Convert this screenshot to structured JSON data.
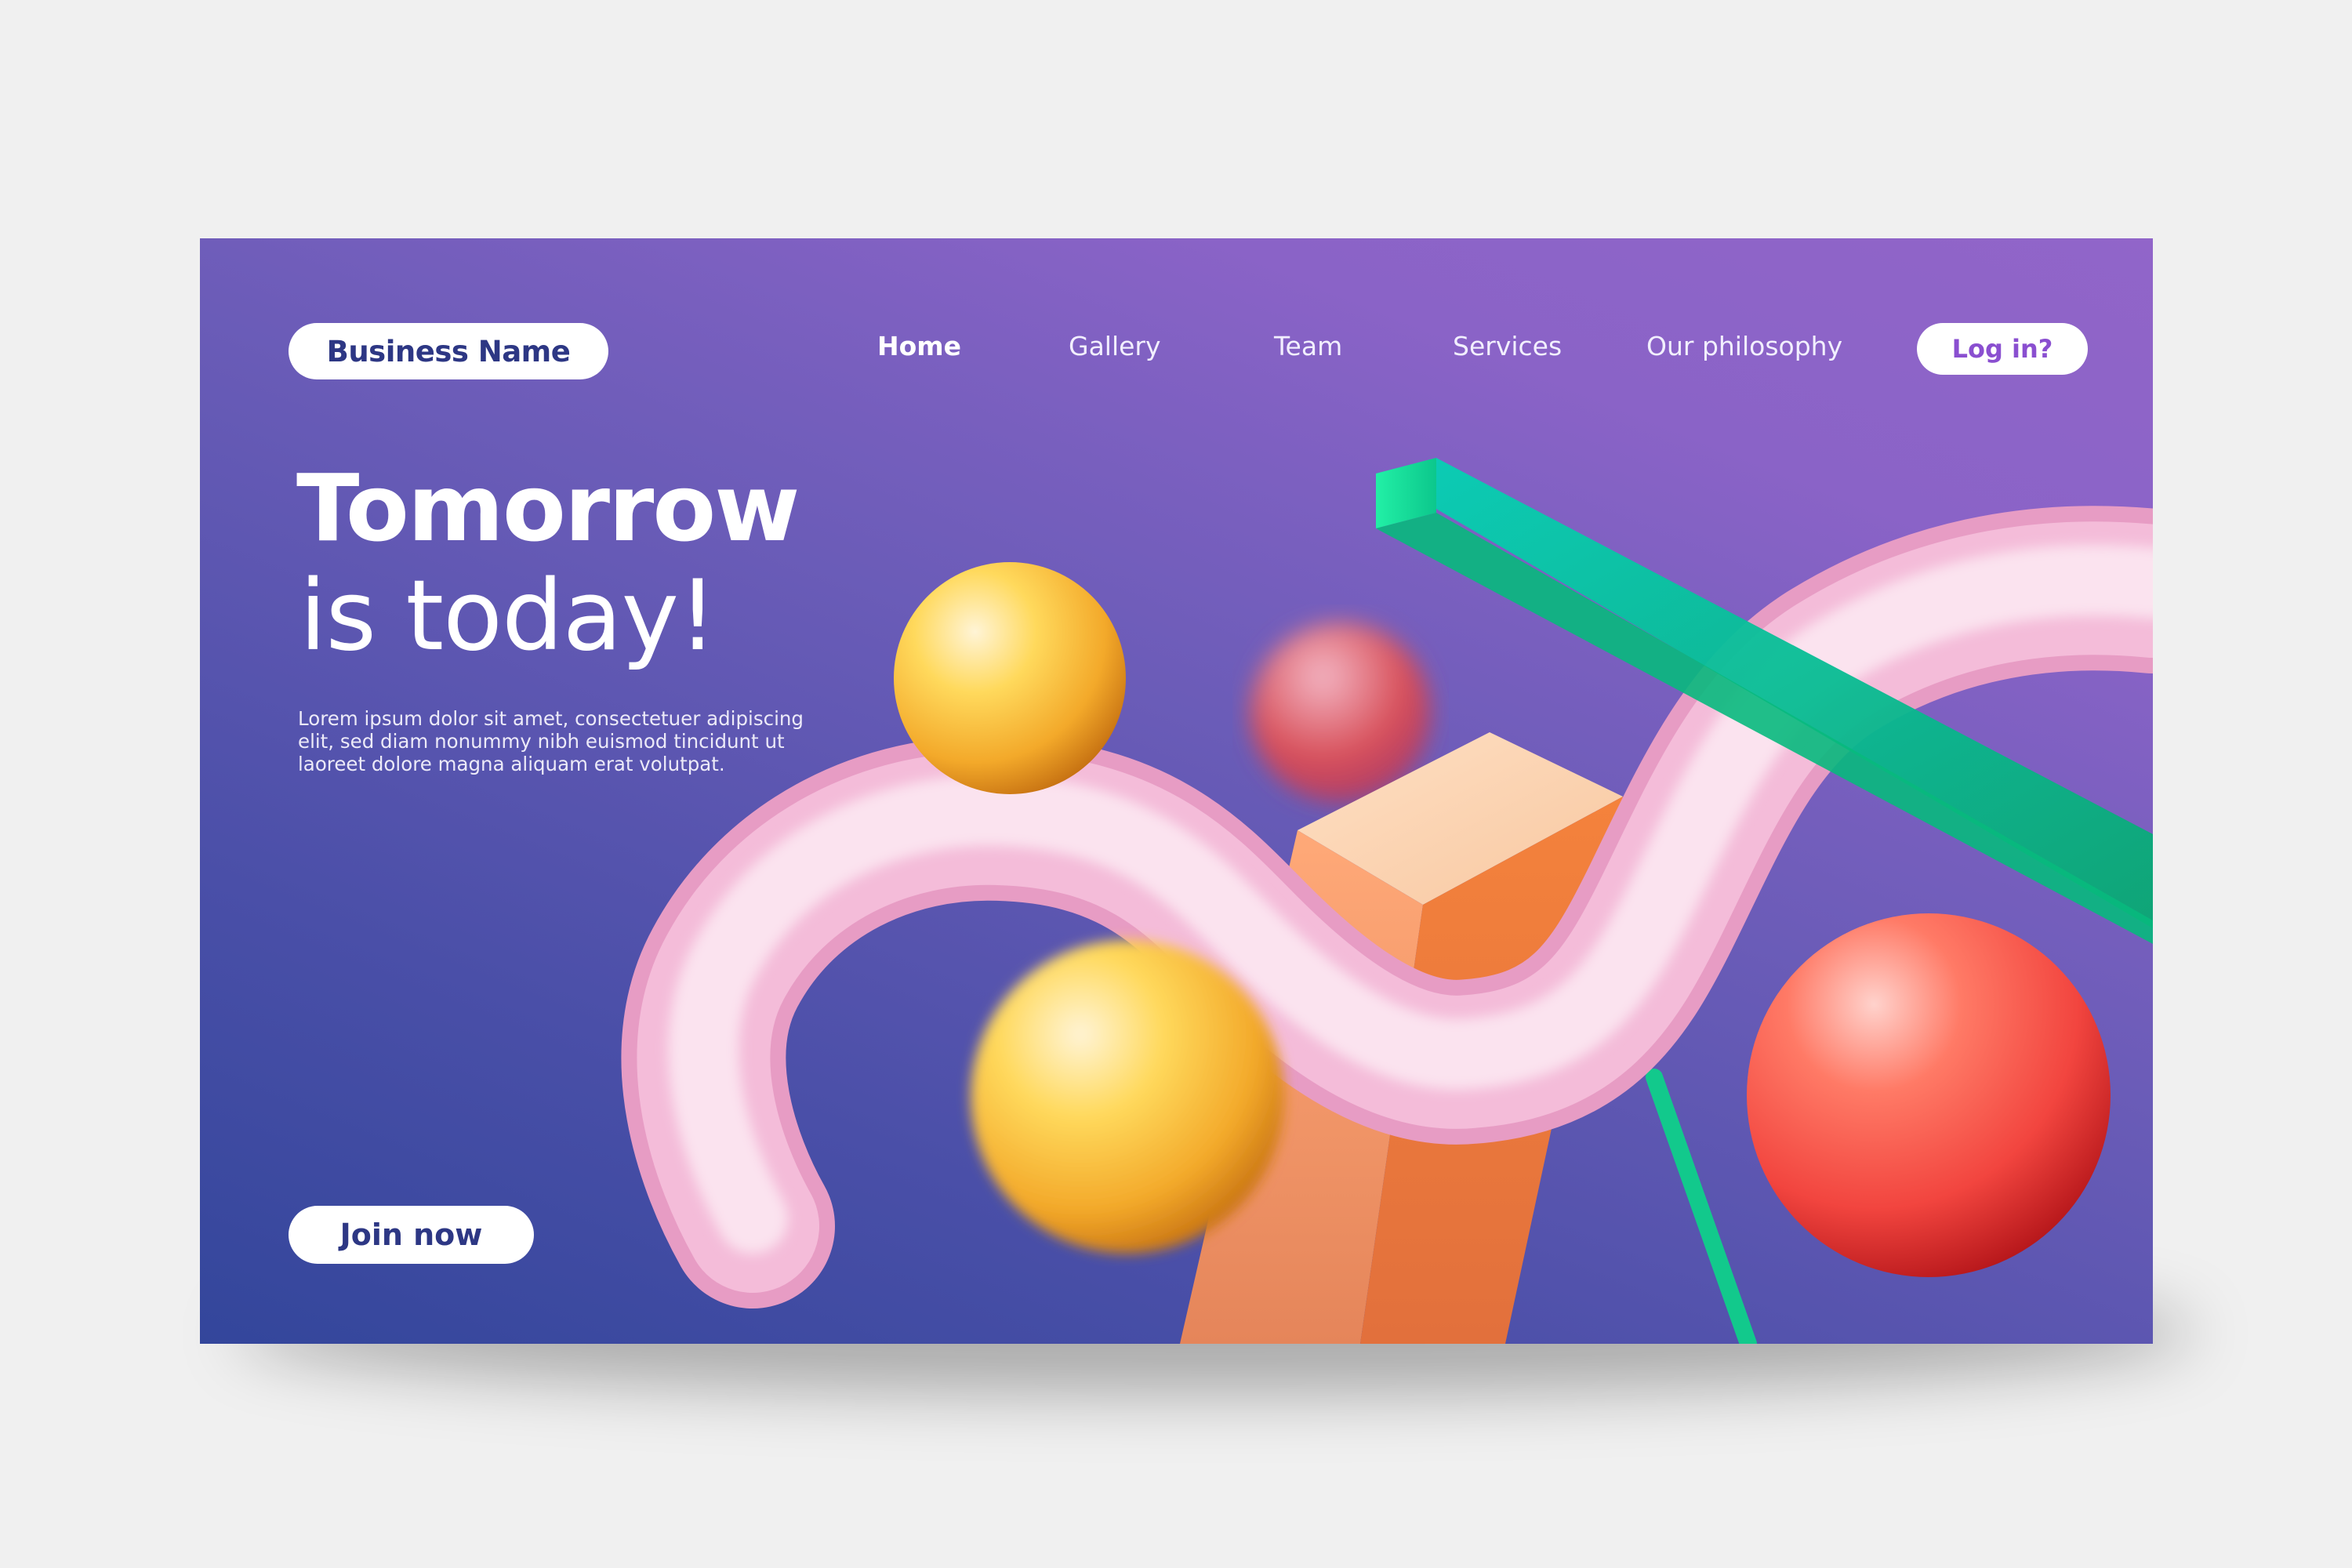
{
  "header": {
    "brand_label": "Business Name",
    "nav": [
      {
        "label": "Home",
        "active": true
      },
      {
        "label": "Gallery",
        "active": false
      },
      {
        "label": "Team",
        "active": false
      },
      {
        "label": "Services",
        "active": false
      },
      {
        "label": "Our philosophy",
        "active": false
      }
    ],
    "login_label": "Log in?"
  },
  "hero": {
    "headline_bold": "Tomorrow",
    "headline_light": "is today!",
    "body": "Lorem ipsum dolor sit amet, consectetuer adipiscing elit, sed diam nonummy nibh euismod tincidunt ut laoreet dolore magna aliquam erat volutpat.",
    "cta_label": "Join now"
  },
  "colors": {
    "page_background": "#f0f0f0",
    "gradient_start": "#33469b",
    "gradient_end": "#9165c9",
    "brand_text": "#2d3784",
    "login_text": "#8a4fd0",
    "pink_tube": "#f2a6cf",
    "orange_block": "#f58a4a",
    "green_bar": "#0fd49a",
    "yellow_sphere": "#f7b733",
    "red_sphere": "#f2453f"
  }
}
